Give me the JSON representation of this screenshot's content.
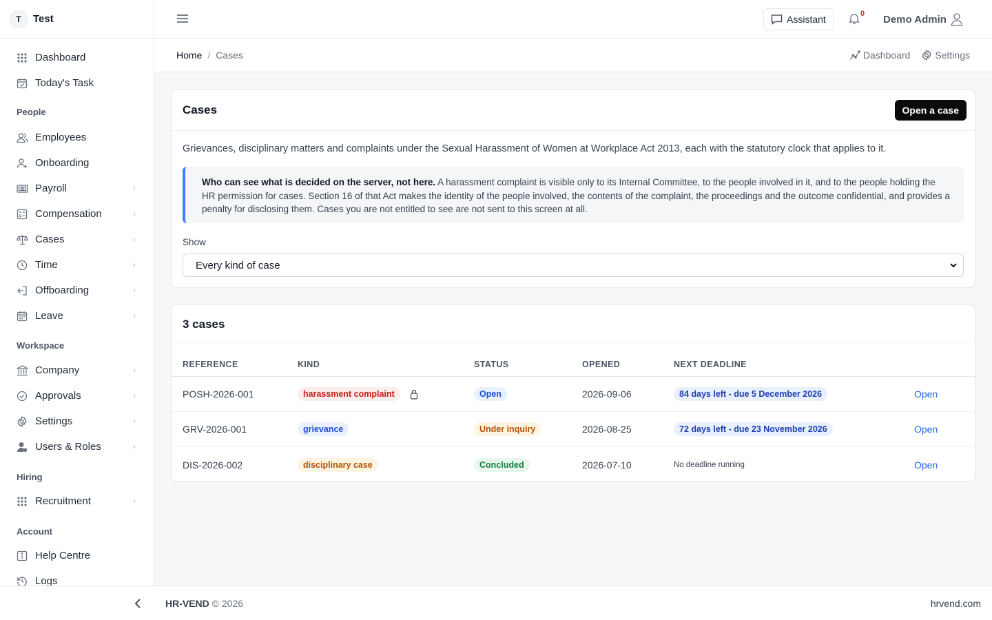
{
  "brand": {
    "initial": "T",
    "name": "Test"
  },
  "sidebar": {
    "top_items": [
      {
        "label": "Dashboard",
        "icon": "grid-icon"
      },
      {
        "label": "Today's Task",
        "icon": "calendar-check-icon"
      }
    ],
    "sections": {
      "people": "People",
      "workspace": "Workspace",
      "hiring": "Hiring",
      "account": "Account"
    },
    "people_items": [
      {
        "label": "Employees",
        "icon": "users-icon"
      },
      {
        "label": "Onboarding",
        "icon": "user-plus-icon"
      },
      {
        "label": "Payroll",
        "icon": "banknote-icon"
      },
      {
        "label": "Compensation",
        "icon": "calculator-icon"
      },
      {
        "label": "Cases",
        "icon": "scale-icon"
      },
      {
        "label": "Time",
        "icon": "clock-icon"
      },
      {
        "label": "Offboarding",
        "icon": "log-out-icon"
      },
      {
        "label": "Leave",
        "icon": "calendar-icon"
      }
    ],
    "workspace_items": [
      {
        "label": "Company",
        "icon": "building-icon"
      },
      {
        "label": "Approvals",
        "icon": "check-circle-icon"
      },
      {
        "label": "Settings",
        "icon": "gear-icon"
      },
      {
        "label": "Users & Roles",
        "icon": "user-shield-icon"
      }
    ],
    "hiring_items": [
      {
        "label": "Recruitment",
        "icon": "grid-icon"
      }
    ],
    "account_items": [
      {
        "label": "Help Centre",
        "icon": "info-icon"
      },
      {
        "label": "Logs",
        "icon": "history-icon"
      }
    ]
  },
  "topbar": {
    "assistant_label": "Assistant",
    "notification_count": "0",
    "user_name": "Demo Admin"
  },
  "breadcrumb": {
    "home": "Home",
    "separator": "/",
    "current": "Cases",
    "actions": {
      "dashboard": "Dashboard",
      "settings": "Settings"
    }
  },
  "cases_card": {
    "title": "Cases",
    "open_case_label": "Open a case",
    "description": "Grievances, disciplinary matters and complaints under the Sexual Harassment of Women at Workplace Act 2013, each with the statutory clock that applies to it.",
    "notice_bold": "Who can see what is decided on the server, not here.",
    "notice_text": " A harassment complaint is visible only to its Internal Committee, to the people involved in it, and to the people holding the HR permission for cases. Section 16 of that Act makes the identity of the people involved, the contents of the complaint, the proceedings and the outcome confidential, and provides a penalty for disclosing them. Cases you are not entitled to see are not sent to this screen at all.",
    "show_label": "Show",
    "show_value": "Every kind of case"
  },
  "table": {
    "title": "3 cases",
    "headers": {
      "reference": "REFERENCE",
      "kind": "KIND",
      "status": "STATUS",
      "opened": "OPENED",
      "deadline": "NEXT DEADLINE"
    },
    "rows": [
      {
        "reference": "POSH-2026-001",
        "kind": "harassment complaint",
        "kind_color": "#c81e1e",
        "locked": true,
        "status": "Open",
        "status_color": "#1d4ed8",
        "opened": "2026-09-06",
        "deadline": "84 days left - due 5 December 2026",
        "deadline_pill": true,
        "action": "Open"
      },
      {
        "reference": "GRV-2026-001",
        "kind": "grievance",
        "kind_color": "#1d4ed8",
        "locked": false,
        "status": "Under inquiry",
        "status_color": "#b45309",
        "opened": "2026-08-25",
        "deadline": "72 days left - due 23 November 2026",
        "deadline_pill": true,
        "action": "Open"
      },
      {
        "reference": "DIS-2026-002",
        "kind": "disciplinary case",
        "kind_color": "#b45309",
        "locked": false,
        "status": "Concluded",
        "status_color": "#15803d",
        "opened": "2026-07-10",
        "deadline": "No deadline running",
        "deadline_pill": false,
        "action": "Open"
      }
    ]
  },
  "footer": {
    "brand": "HR-VEND",
    "copyright": "© 2026",
    "site": "hrvend.com"
  }
}
